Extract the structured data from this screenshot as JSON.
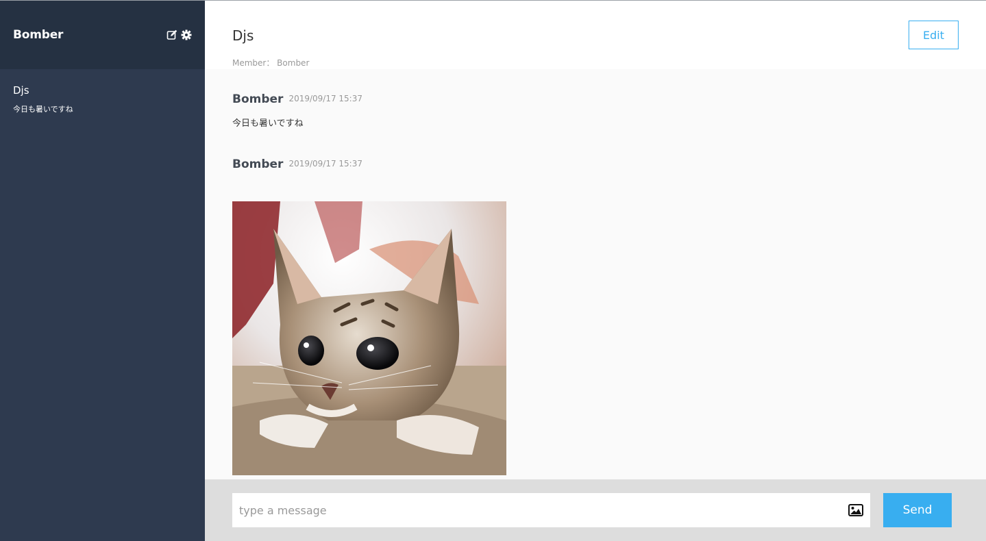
{
  "sidebar": {
    "user_name": "Bomber",
    "groups": [
      {
        "name": "Djs",
        "last_message": "今日も暑いですね"
      }
    ]
  },
  "main": {
    "chat_title": "Djs",
    "member_text": "Member： Bomber",
    "edit_label": "Edit",
    "messages": [
      {
        "user": "Bomber",
        "date": "2019/09/17 15:37",
        "text": "今日も暑いですね"
      },
      {
        "user": "Bomber",
        "date": "2019/09/17 15:37",
        "image": "kitten-photo"
      }
    ]
  },
  "form": {
    "placeholder": "type a message",
    "image_icon": "image-icon",
    "send_label": "Send"
  },
  "colors": {
    "sidebar_bg": "#2e3a4f",
    "sidebar_header_bg": "#253142",
    "accent": "#38aef0",
    "form_bg": "#dddddd"
  }
}
